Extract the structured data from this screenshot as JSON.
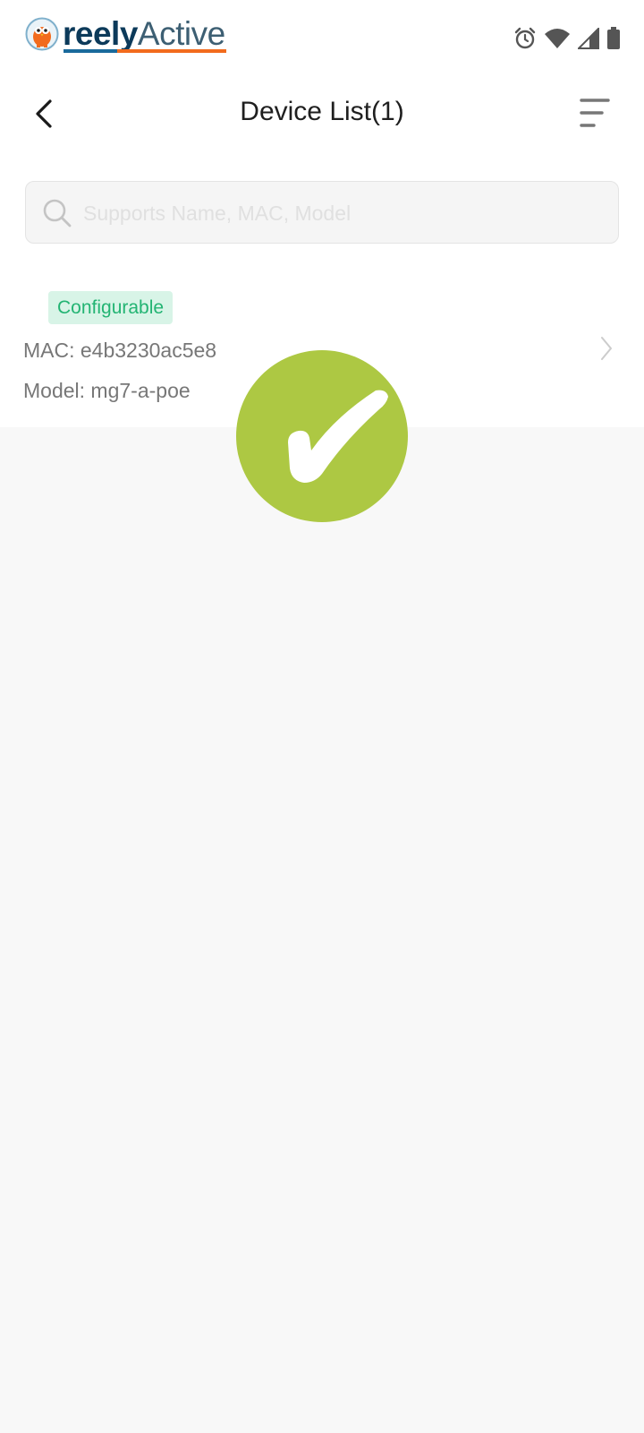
{
  "brand": {
    "name_part1": "reely",
    "name_part2": "Active"
  },
  "header": {
    "title": "Device List(1)"
  },
  "search": {
    "placeholder": "Supports Name, MAC, Model",
    "value": ""
  },
  "devices": [
    {
      "status": "Configurable",
      "mac": "MAC: e4b3230ac5e8",
      "model": "Model: mg7-a-poe"
    }
  ],
  "colors": {
    "badge_bg": "#d8f4e7",
    "badge_text": "#23b473",
    "success": "#adc843",
    "logo_blue": "#1a6a9c",
    "logo_orange": "#f26b1d"
  },
  "icons": [
    "owl-logo-icon",
    "alarm-icon",
    "wifi-icon",
    "signal-icon",
    "battery-icon",
    "back-arrow-icon",
    "filter-sort-icon",
    "search-icon",
    "chevron-right-icon",
    "checkmark-icon"
  ]
}
